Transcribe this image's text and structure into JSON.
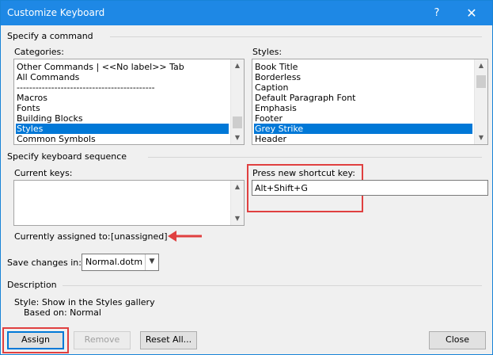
{
  "window": {
    "title": "Customize Keyboard",
    "help_glyph": "?",
    "close_glyph": "✕"
  },
  "specify_command": {
    "header": "Specify a command",
    "categories_label": "Categories:",
    "categories": [
      "Other Commands | <<No label>> Tab",
      "All Commands",
      "--------------------------------------------",
      "Macros",
      "Fonts",
      "Building Blocks",
      "Styles",
      "Common Symbols"
    ],
    "selected_category": "Styles",
    "styles_label": "Styles:",
    "styles": [
      "Book Title",
      "Borderless",
      "Caption",
      "Default Paragraph Font",
      "Emphasis",
      "Footer",
      "Grey Strike",
      "Header"
    ],
    "selected_style": "Grey Strike"
  },
  "keyboard_sequence": {
    "header": "Specify keyboard sequence",
    "current_keys_label": "Current keys:",
    "press_new_label": "Press new shortcut key:",
    "new_shortcut_value": "Alt+Shift+G",
    "currently_assigned_label": "Currently assigned to:",
    "currently_assigned_value": "[unassigned]"
  },
  "save_changes": {
    "label": "Save changes in:",
    "value": "Normal.dotm"
  },
  "description": {
    "header": "Description",
    "line1": "Style: Show in the Styles gallery",
    "line2": "Based on: Normal"
  },
  "buttons": {
    "assign": "Assign",
    "remove": "Remove",
    "reset_all": "Reset All...",
    "close": "Close"
  },
  "annotation_color": "#e04040"
}
